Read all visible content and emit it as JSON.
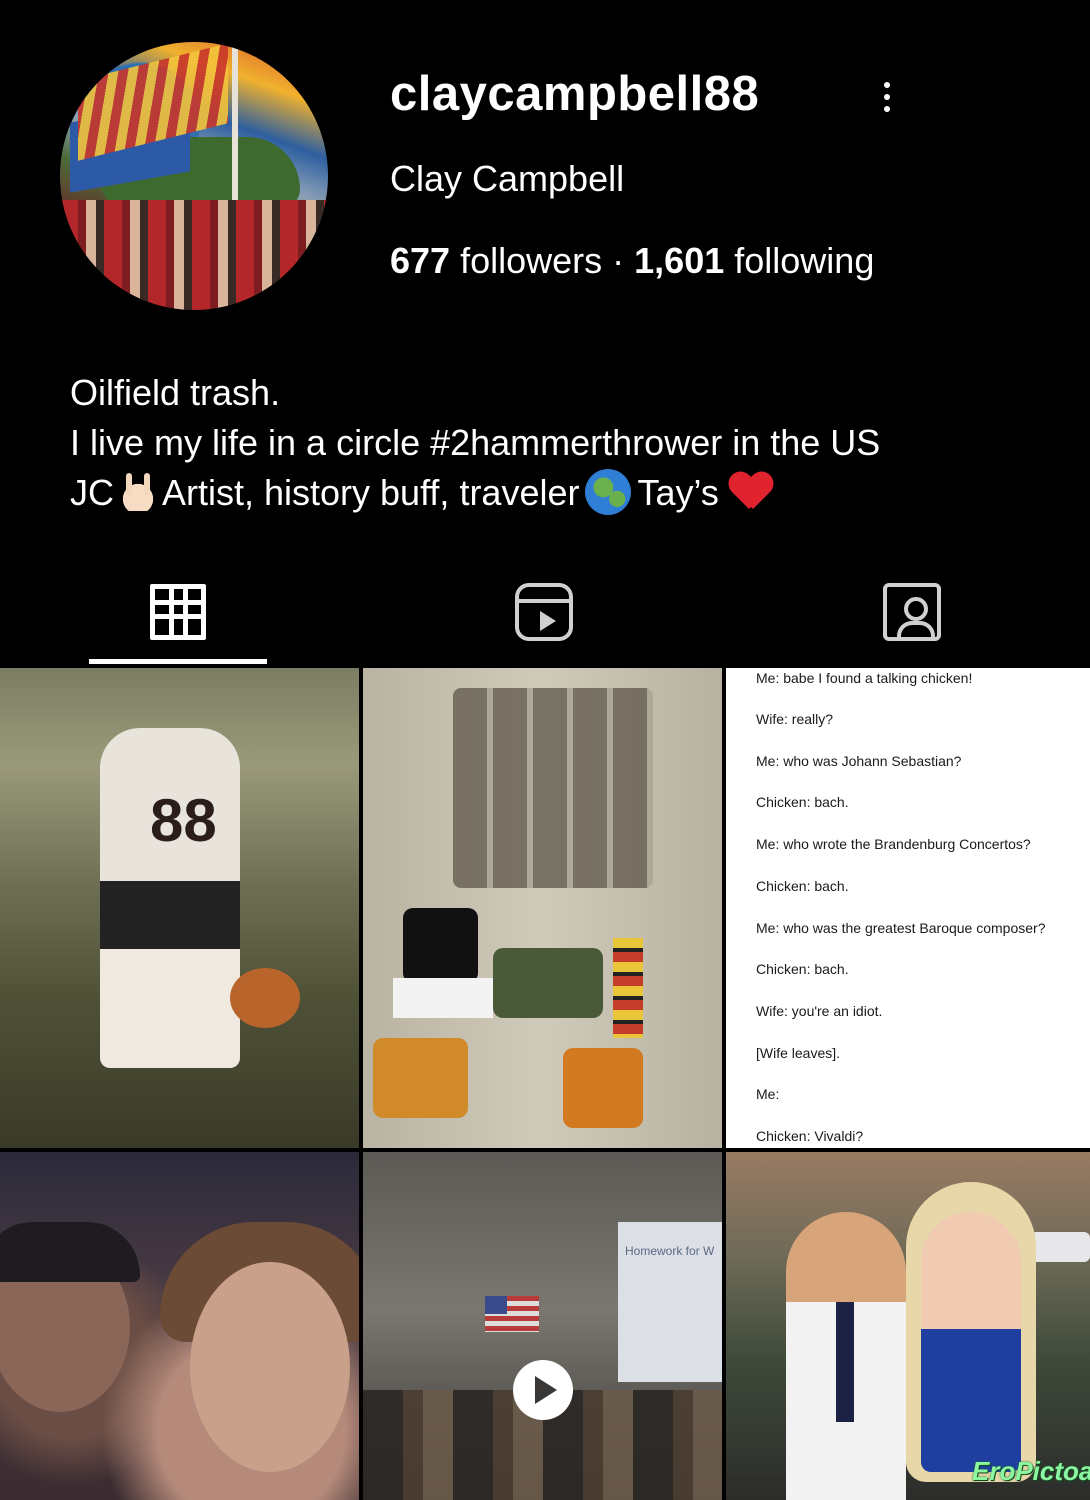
{
  "profile": {
    "username": "claycampbell88",
    "full_name": "Clay Campbell",
    "followers_count": "677",
    "followers_label": "followers",
    "separator": "·",
    "following_count": "1,601",
    "following_label": "following",
    "bio": {
      "line1": "Oilfield trash.",
      "line2": "I live my life in a circle #2hammerthrower in the US",
      "line3_prefix": "JC",
      "line3_mid": "Artist, history buff, traveler",
      "line3_suffix": "Tay’s"
    }
  },
  "icons": {
    "more": "more-vertical-icon",
    "grid": "grid-icon",
    "reels": "reels-icon",
    "tagged": "tagged-icon"
  },
  "posts": {
    "text_post_lines": [
      "Me: babe I found a talking chicken!",
      "Wife: really?",
      "Me: who was Johann Sebastian?",
      "Chicken: bach.",
      "Me: who wrote the Brandenburg Concertos?",
      "Chicken: bach.",
      "Me: who was the greatest Baroque composer?",
      "Chicken: bach.",
      "Wife: you're an idiot.",
      "[Wife leaves].",
      "Me:",
      "Chicken: Vivaldi?"
    ],
    "jersey_number": "88",
    "classroom_screen_title": "Homework for W"
  },
  "watermark": "EroPictoa"
}
